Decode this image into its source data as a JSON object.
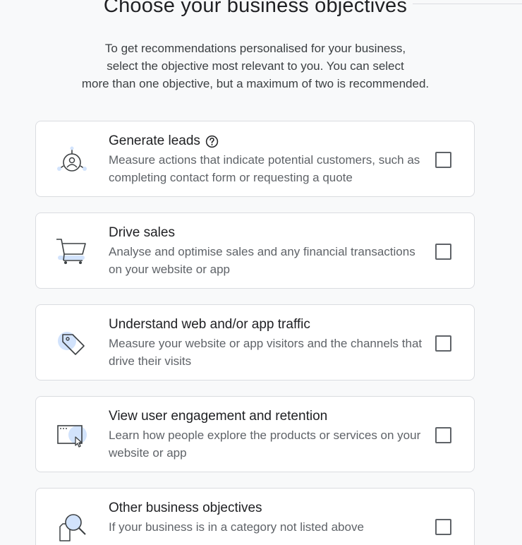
{
  "header": {
    "title": "Choose your business objectives",
    "subtitle_lines": [
      "To get recommendations personalised for your business,",
      "select the objective most relevant to you. You can select",
      "more than one objective, but a maximum of two is recommended."
    ]
  },
  "objectives": [
    {
      "icon": "leads-target-icon",
      "title": "Generate leads",
      "has_help": true,
      "description": "Measure actions that indicate potential customers, such as completing contact form or requesting a quote",
      "checked": false
    },
    {
      "icon": "shopping-cart-icon",
      "title": "Drive sales",
      "has_help": false,
      "description": "Analyse and optimise sales and any financial transactions on your website or app",
      "checked": false
    },
    {
      "icon": "tag-icon",
      "title": "Understand web and/or app traffic",
      "has_help": false,
      "description": "Measure your website or app visitors and the channels that drive their visits",
      "checked": false
    },
    {
      "icon": "browser-cursor-icon",
      "title": "View user engagement and retention",
      "has_help": false,
      "description": "Learn how people explore the products or services on your website or app",
      "checked": false
    },
    {
      "icon": "magnifier-document-icon",
      "title": "Other business objectives",
      "has_help": false,
      "description": "If your business is in a category not listed above",
      "checked": false
    }
  ],
  "colors": {
    "accent_light": "#d2e3fc",
    "icon_stroke": "#3c4043",
    "card_border": "#dadce0",
    "background": "#f8f9fa"
  }
}
